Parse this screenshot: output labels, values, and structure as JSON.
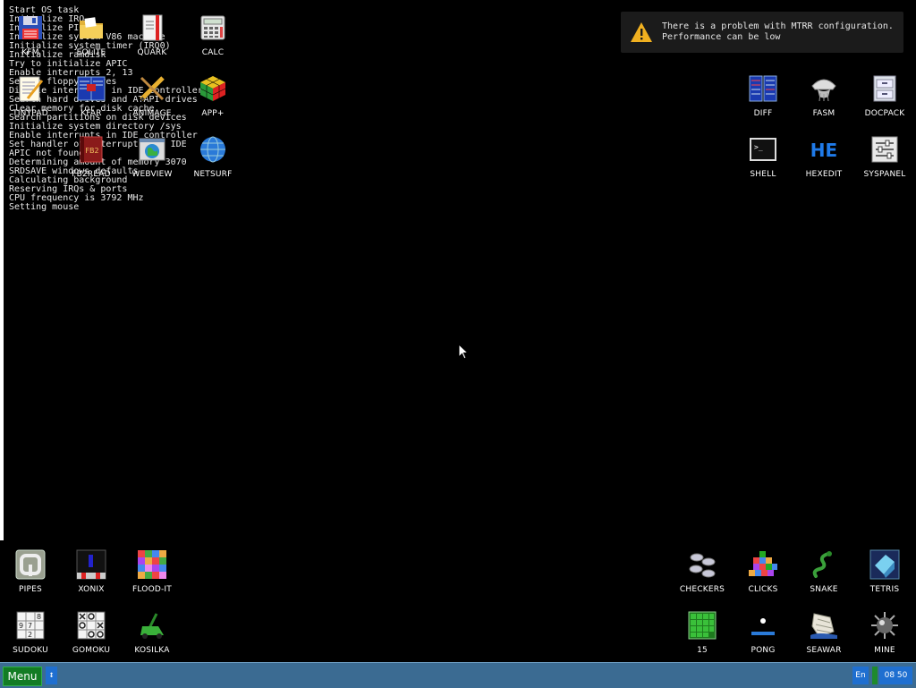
{
  "boot_log": [
    "Start OS task",
    "Initialize IRQ",
    "Initialize PIC",
    "Initialize system V86 machine",
    "Initialize system timer (IRQ0)",
    "Initialize ramdisk",
    "Try to initialize APIC",
    "Enable interrupts 2, 13",
    "Search floppy drives",
    "Disable interrupts in IDE controller",
    "Search hard drives and ATAPI drives",
    "Clear memory for disk cache",
    "Search partitions on disk devices",
    "Initialize system directory /sys",
    "Enable interrupts in IDE controller",
    "Set handler of interrupts for IDE",
    "APIC not found",
    "Determining amount of memory 3070",
    "SRDSAVE windows defaults",
    "Calculating background",
    "Reserving IRQs & ports",
    "CPU frequency is 3792 MHz",
    "Setting mouse"
  ],
  "desktop": {
    "top_left": [
      {
        "label": "KFM",
        "icon": "floppy-icon"
      },
      {
        "label": "EOLITE",
        "icon": "folder-icon"
      },
      {
        "label": "QUARK",
        "icon": "notebook-icon"
      },
      {
        "label": "CALC",
        "icon": "calculator-icon"
      },
      {
        "label": "TINYPAD",
        "icon": "notepad-icon"
      },
      {
        "label": "KFAR",
        "icon": "panels-icon"
      },
      {
        "label": "ANIMAGE",
        "icon": "pencil-icon"
      },
      {
        "label": "APP+",
        "icon": "cube-icon"
      },
      {
        "label": "FB2READ",
        "icon": "book-icon"
      },
      {
        "label": "WEBVIEW",
        "icon": "web-page-icon"
      },
      {
        "label": "NETSURF",
        "icon": "globe-icon"
      }
    ],
    "top_right": [
      {
        "label": "DIFF",
        "icon": "diff-icon"
      },
      {
        "label": "FASM",
        "icon": "fasm-icon"
      },
      {
        "label": "DOCPACK",
        "icon": "drawer-icon"
      },
      {
        "label": "SHELL",
        "icon": "terminal-icon"
      },
      {
        "label": "HEXEDIT",
        "icon": "hex-icon"
      },
      {
        "label": "SYSPANEL",
        "icon": "sliders-icon"
      }
    ],
    "bottom_left": [
      {
        "label": "PIPES",
        "icon": "pipes-icon"
      },
      {
        "label": "XONIX",
        "icon": "xonix-icon"
      },
      {
        "label": "FLOOD-IT",
        "icon": "color-grid-icon"
      },
      {
        "label": "SUDOKU",
        "icon": "sudoku-icon"
      },
      {
        "label": "GOMOKU",
        "icon": "gomoku-icon"
      },
      {
        "label": "KOSILKA",
        "icon": "lawnmower-icon"
      }
    ],
    "bottom_right": [
      {
        "label": "CHECKERS",
        "icon": "checkers-icon"
      },
      {
        "label": "CLICKS",
        "icon": "blocks-icon"
      },
      {
        "label": "SNAKE",
        "icon": "snake-icon"
      },
      {
        "label": "TETRIS",
        "icon": "tetris-icon"
      },
      {
        "label": "15",
        "icon": "fifteen-icon"
      },
      {
        "label": "PONG",
        "icon": "pong-icon"
      },
      {
        "label": "SEAWAR",
        "icon": "ship-icon"
      },
      {
        "label": "MINE",
        "icon": "mine-icon"
      }
    ]
  },
  "notification": {
    "line1": "There is a problem with MTRR configuration.",
    "line2": "Performance can be low",
    "icon": "warning-icon"
  },
  "taskbar": {
    "menu_label": "Menu",
    "switch_glyph": "↕",
    "lang": "En",
    "clock": "08 50"
  },
  "colors": {
    "taskbar": "#3b6b92",
    "menu_button": "#137c24",
    "tray_blue": "#1f6fd0",
    "warning": "#f0b020"
  }
}
